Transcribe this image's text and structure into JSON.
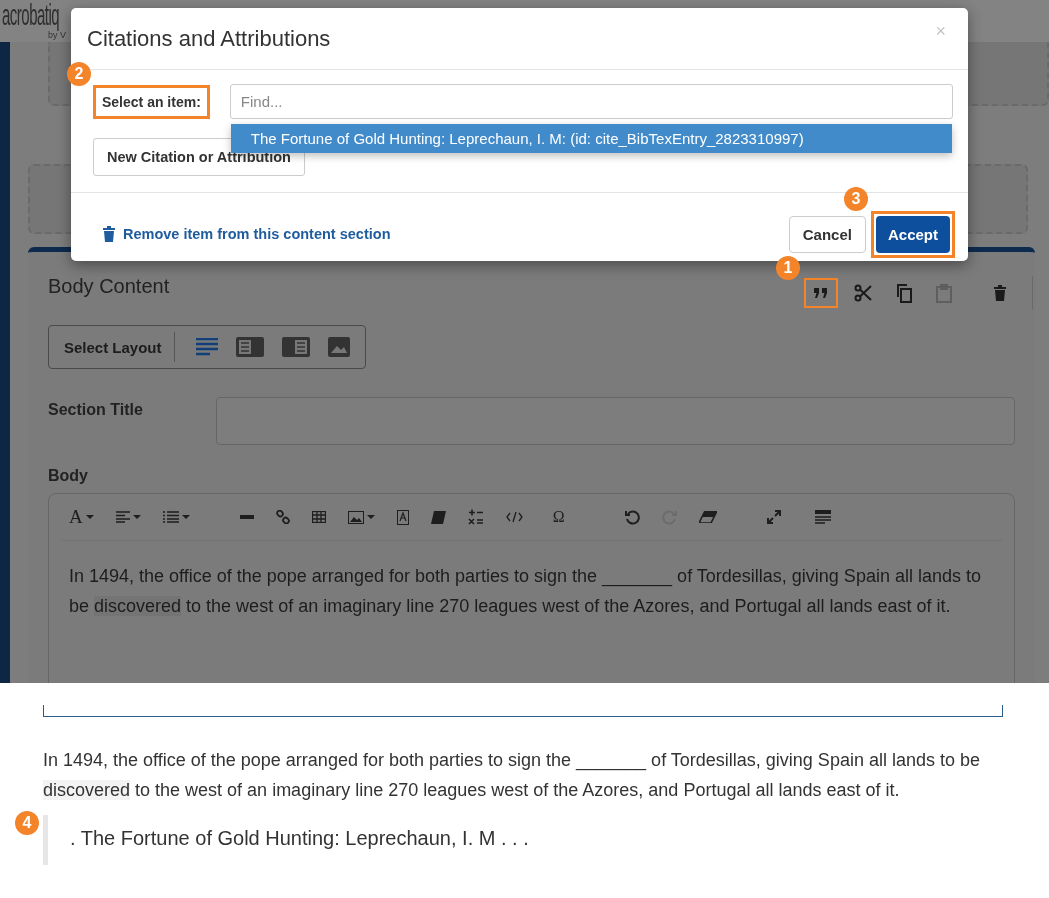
{
  "logo": {
    "name": "acrobatiq",
    "byline": "by V"
  },
  "modal": {
    "title": "Citations and Attributions",
    "close": "×",
    "select_label": "Select an item:",
    "select_label_callout": "2",
    "find_placeholder": "Find...",
    "options": [
      {
        "label": "The Fortune of Gold Hunting: Leprechaun, I. M: (id: cite_BibTexEntry_2823310997)",
        "selected": true
      }
    ],
    "new_button": "New Citation or Attribution",
    "remove_link": "Remove item from this content section",
    "cancel": "Cancel",
    "accept": "Accept",
    "accept_callout": "3"
  },
  "panel": {
    "title": "Body Content",
    "actions": [
      {
        "kind": "quote",
        "disabled": false,
        "highlighted": true,
        "callout": "1"
      },
      {
        "kind": "cut",
        "disabled": false,
        "highlighted": false
      },
      {
        "kind": "copy",
        "disabled": false,
        "highlighted": false
      },
      {
        "kind": "paste",
        "disabled": true,
        "highlighted": false
      },
      {
        "kind": "delete",
        "disabled": false,
        "highlighted": false
      }
    ],
    "layout_label": "Select Layout",
    "layouts": [
      {
        "kind": "full",
        "selected": true
      },
      {
        "kind": "left",
        "selected": false
      },
      {
        "kind": "right",
        "selected": false
      },
      {
        "kind": "image",
        "selected": false
      }
    ],
    "section_title_label": "Section Title",
    "body_label": "Body",
    "tools": [
      {
        "kind": "font",
        "label": "A",
        "disabled": false
      },
      {
        "kind": "align",
        "disabled": false
      },
      {
        "kind": "list",
        "disabled": false
      },
      {
        "kind": "rule",
        "disabled": false
      },
      {
        "kind": "link",
        "disabled": false
      },
      {
        "kind": "table",
        "disabled": false
      },
      {
        "kind": "image",
        "disabled": false
      },
      {
        "kind": "textbox",
        "disabled": false
      },
      {
        "kind": "book",
        "disabled": false
      },
      {
        "kind": "math",
        "disabled": false
      },
      {
        "kind": "code",
        "disabled": false
      },
      {
        "kind": "symbol",
        "label": "Ω",
        "disabled": false
      },
      {
        "kind": "undo",
        "disabled": false
      },
      {
        "kind": "redo",
        "disabled": true
      },
      {
        "kind": "eraser",
        "disabled": false
      },
      {
        "kind": "expand",
        "disabled": false
      },
      {
        "kind": "lorem",
        "disabled": false
      }
    ],
    "body_text": [
      "In 1494, the office of the pope arranged for both parties to sign the _______ of Tordesillas, giving Spain all lands to be ",
      "discovered",
      " to the west of an imaginary line 270 leagues west of the Azores, and Portugal all lands east of it."
    ]
  },
  "preview": {
    "text": [
      "In 1494, the office of the pope arranged for both parties to sign the _______ of Tordesillas, giving Spain all lands to be ",
      "discovered",
      " to the west of an imaginary line 270 leagues west of the Azores, and Portugal all lands east of it."
    ],
    "citation": ". The Fortune of Gold Hunting: Leprechaun, I. M . . .",
    "citation_callout": "4"
  }
}
